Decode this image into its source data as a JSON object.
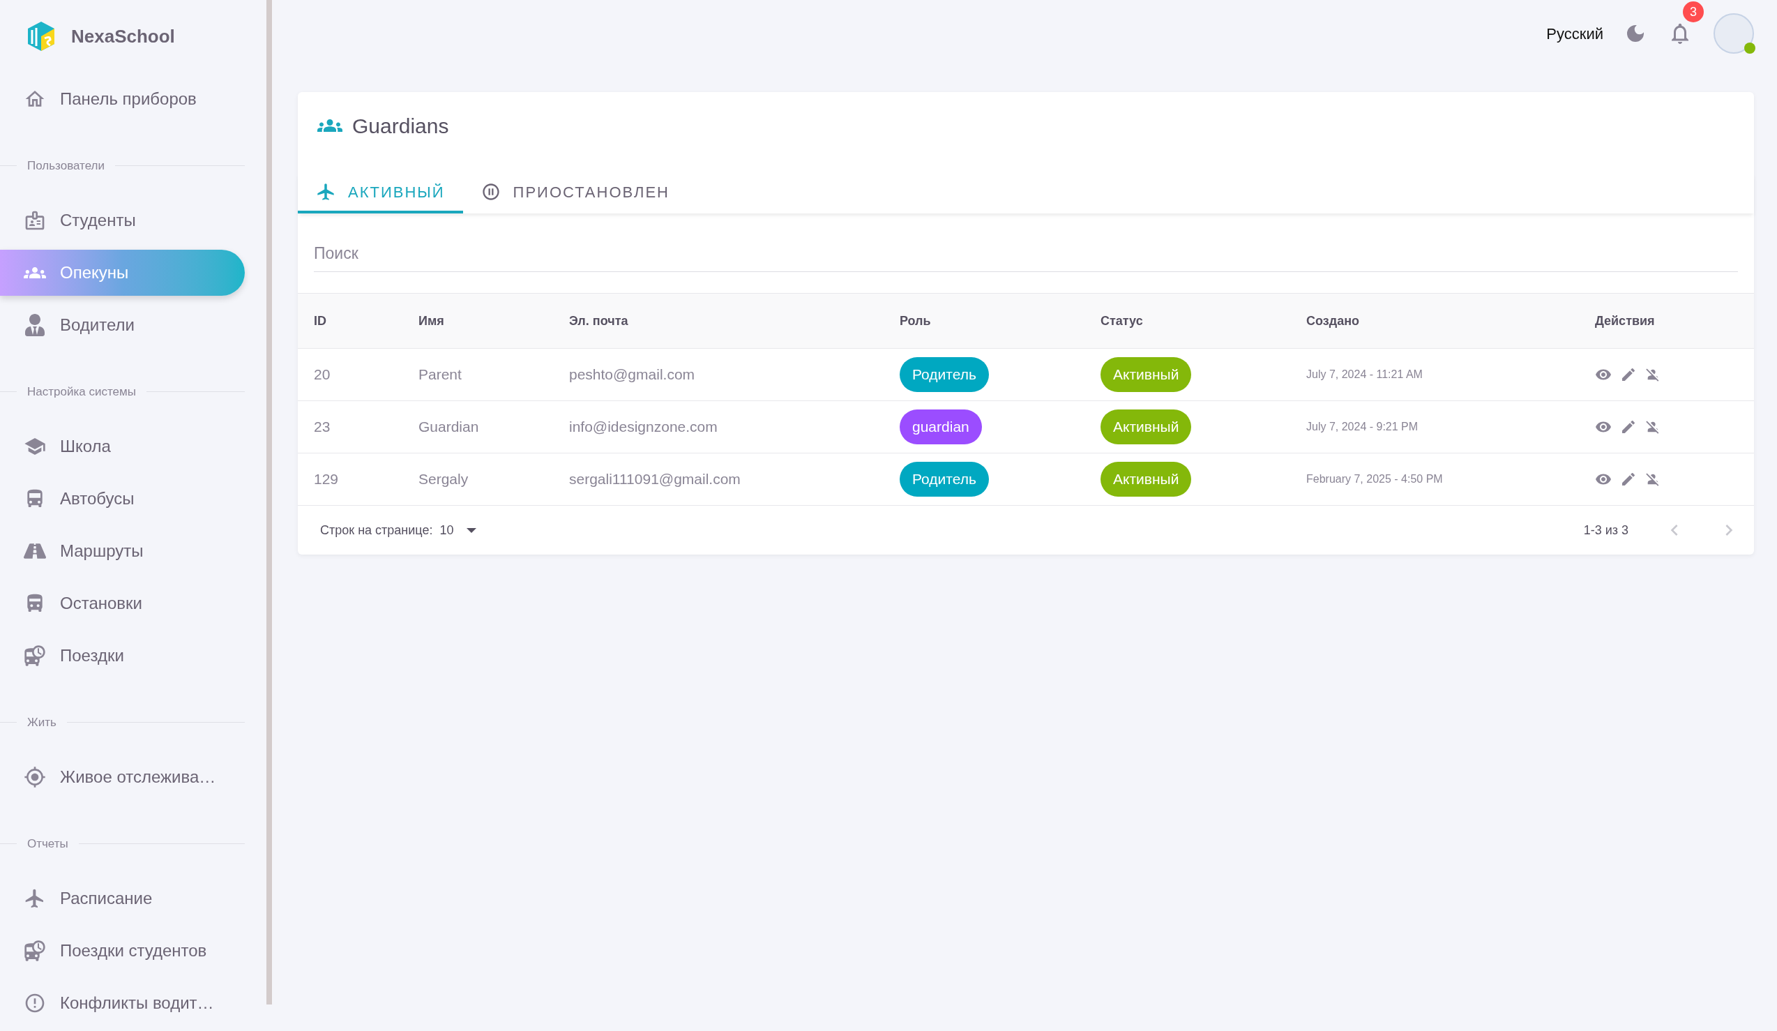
{
  "brand": {
    "name": "NexaSchool"
  },
  "sidebar": {
    "items": [
      {
        "kind": "item",
        "label": "Панель приборов",
        "selected": false
      },
      {
        "kind": "section",
        "label": "Пользователи"
      },
      {
        "kind": "item",
        "label": "Студенты",
        "selected": false
      },
      {
        "kind": "item",
        "label": "Опекуны",
        "selected": true
      },
      {
        "kind": "item",
        "label": "Водители",
        "selected": false
      },
      {
        "kind": "section",
        "label": "Настройка системы"
      },
      {
        "kind": "item",
        "label": "Школа",
        "selected": false
      },
      {
        "kind": "item",
        "label": "Автобусы",
        "selected": false
      },
      {
        "kind": "item",
        "label": "Маршруты",
        "selected": false
      },
      {
        "kind": "item",
        "label": "Остановки",
        "selected": false
      },
      {
        "kind": "item",
        "label": "Поездки",
        "selected": false
      },
      {
        "kind": "section",
        "label": "Жить"
      },
      {
        "kind": "item",
        "label": "Живое отслежива…",
        "selected": false
      },
      {
        "kind": "section",
        "label": "Отчеты"
      },
      {
        "kind": "item",
        "label": "Расписание",
        "selected": false
      },
      {
        "kind": "item",
        "label": "Поездки студентов",
        "selected": false
      },
      {
        "kind": "item",
        "label": "Конфликты водит…",
        "selected": false
      }
    ]
  },
  "header": {
    "language": "Русский",
    "notifications": "3",
    "avatar": {
      "online": true
    }
  },
  "page": {
    "title": "Guardians"
  },
  "tabs": [
    {
      "label": "АКТИВНЫЙ",
      "selected": true
    },
    {
      "label": "ПРИОСТАНОВЛЕН",
      "selected": false
    }
  ],
  "search": {
    "placeholder": "Поиск"
  },
  "table": {
    "columns": [
      "ID",
      "Имя",
      "Эл. почта",
      "Роль",
      "Статус",
      "Создано",
      "Действия"
    ],
    "rows": [
      {
        "id": "20",
        "name": "Parent",
        "email": "peshto@gmail.com",
        "role": {
          "label": "Родитель",
          "color": "#00a8c1"
        },
        "status": "Активный",
        "created": "July 7, 2024 - 11:21 AM"
      },
      {
        "id": "23",
        "name": "Guardian",
        "email": "info@idesignzone.com",
        "role": {
          "label": "guardian",
          "color": "#9b4dff"
        },
        "status": "Активный",
        "created": "July 7, 2024 - 9:21 PM"
      },
      {
        "id": "129",
        "name": "Sergaly",
        "email": "sergali111091@gmail.com",
        "role": {
          "label": "Родитель",
          "color": "#00a8c1"
        },
        "status": "Активный",
        "created": "February 7, 2025 - 4:50 PM"
      }
    ]
  },
  "pagination": {
    "rows_label": "Строк на странице:",
    "rows_value": "10",
    "range": "1-3 из 3"
  }
}
